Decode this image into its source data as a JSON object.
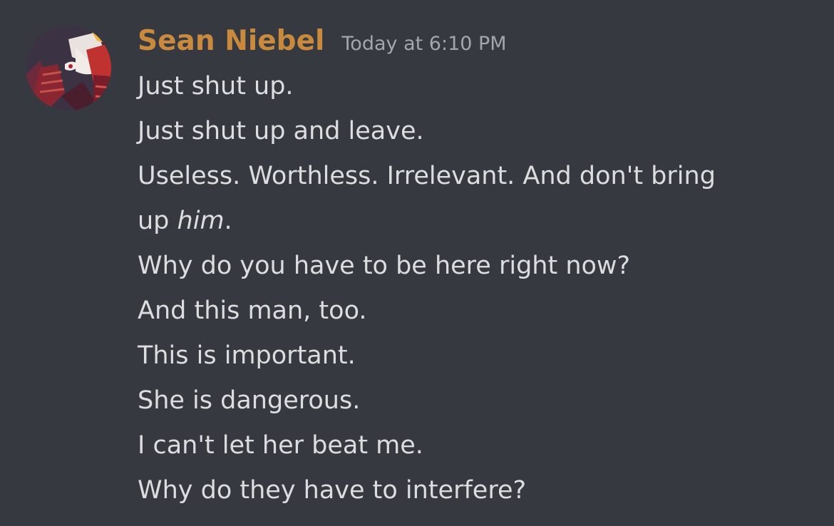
{
  "message": {
    "author": "Sean Niebel",
    "timestamp": "Today at 6:10 PM",
    "author_color": "#c98a3d",
    "avatar_icon": "anime-character-avatar",
    "lines": [
      "Just shut up.",
      "Just shut up and leave.",
      "Useless. Worthless. Irrelevant. And don't bring",
      {
        "prefix": "up ",
        "emphasis": "him",
        "suffix": "."
      },
      "Why do you have to be here right now?",
      "And this man, too.",
      "This is important.",
      "She is dangerous.",
      "I can't let her beat me.",
      "Why do they have to interfere?"
    ]
  },
  "theme": {
    "background": "#36393f",
    "text": "#dcddde",
    "muted": "#a3a6aa"
  }
}
